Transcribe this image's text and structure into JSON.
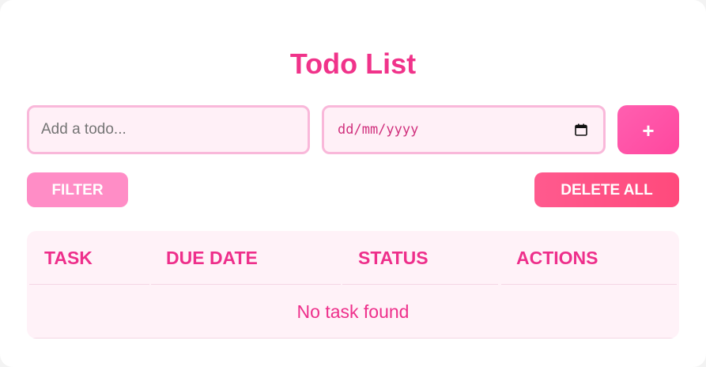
{
  "app": {
    "title": "Todo List"
  },
  "form": {
    "todo_placeholder": "Add a todo...",
    "todo_value": "",
    "date_placeholder": "dd/mm/yyyy",
    "add_label": "+"
  },
  "toolbar": {
    "filter_label": "FILTER",
    "delete_all_label": "DELETE ALL"
  },
  "table": {
    "columns": [
      "TASK",
      "DUE DATE",
      "STATUS",
      "ACTIONS"
    ],
    "empty_message": "No task found"
  },
  "colors": {
    "accent": "#f0338a",
    "add_button": "#ff4fa4",
    "filter_button": "#ff8dc6",
    "delete_button": "#ff5384",
    "input_border": "#f9b8da",
    "input_background": "#fff0f7",
    "table_background": "#fff2f8"
  }
}
